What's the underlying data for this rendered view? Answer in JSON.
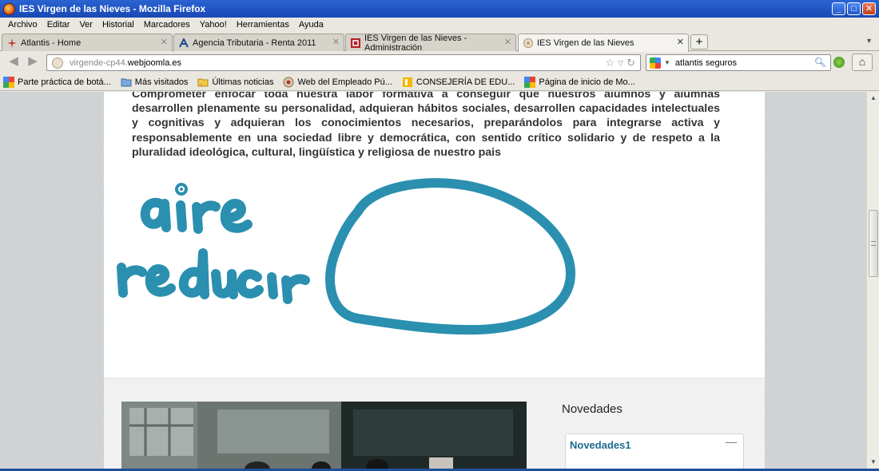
{
  "window": {
    "title": "IES Virgen de las Nieves - Mozilla Firefox"
  },
  "menu": [
    "Archivo",
    "Editar",
    "Ver",
    "Historial",
    "Marcadores",
    "Yahoo!",
    "Herramientas",
    "Ayuda"
  ],
  "tabs": [
    {
      "label": "Atlantis - Home",
      "icon": "atlantis-icon"
    },
    {
      "label": "Agencia Tributaria - Renta 2011",
      "icon": "agencia-tributaria-icon"
    },
    {
      "label": "IES Virgen de las Nieves - Administración",
      "icon": "joomla-icon"
    },
    {
      "label": "IES Virgen de las Nieves",
      "icon": "site-icon",
      "active": true
    }
  ],
  "address": {
    "prefix": "virgende-cp44.",
    "domain": "webjoomla.es"
  },
  "search": {
    "value": "atlantis seguros"
  },
  "bookmarks": [
    {
      "label": "Parte práctica de botá...",
      "icon": "google-icon"
    },
    {
      "label": "Más visitados",
      "icon": "folder-icon"
    },
    {
      "label": "Últimas noticias",
      "icon": "rss-folder-icon"
    },
    {
      "label": "Web del Empleado Pú...",
      "icon": "web-icon"
    },
    {
      "label": "CONSEJERÍA DE EDU...",
      "icon": "consejeria-icon"
    },
    {
      "label": "Página de inicio de Mo...",
      "icon": "google-icon"
    }
  ],
  "content": {
    "paragraph": "Comprometer enfocar toda nuestra labor formativa a conseguir que nuestros alumnos y alumnas desarrollen plenamente su personalidad, adquieran hábitos sociales, desarrollen capacidades intelectuales y cognitivas y adquieran los conocimientos necesarios, preparándolos para integrarse activa y responsablemente en una sociedad libre y democrática, con sentido crítico solidario y de respeto a la pluralidad ideológica, cultural, lingüística y religiosa de nuestro pais",
    "handwriting": {
      "line1": "aire",
      "line2": "reducir",
      "color": "#2b8fb0"
    },
    "news_heading": "Novedades",
    "module_title": "Novedades1",
    "module_collapse": "—"
  },
  "colors": {
    "titlebar": "#2a63d2",
    "link": "#1b6c8e",
    "ink": "#2b8fb0"
  }
}
